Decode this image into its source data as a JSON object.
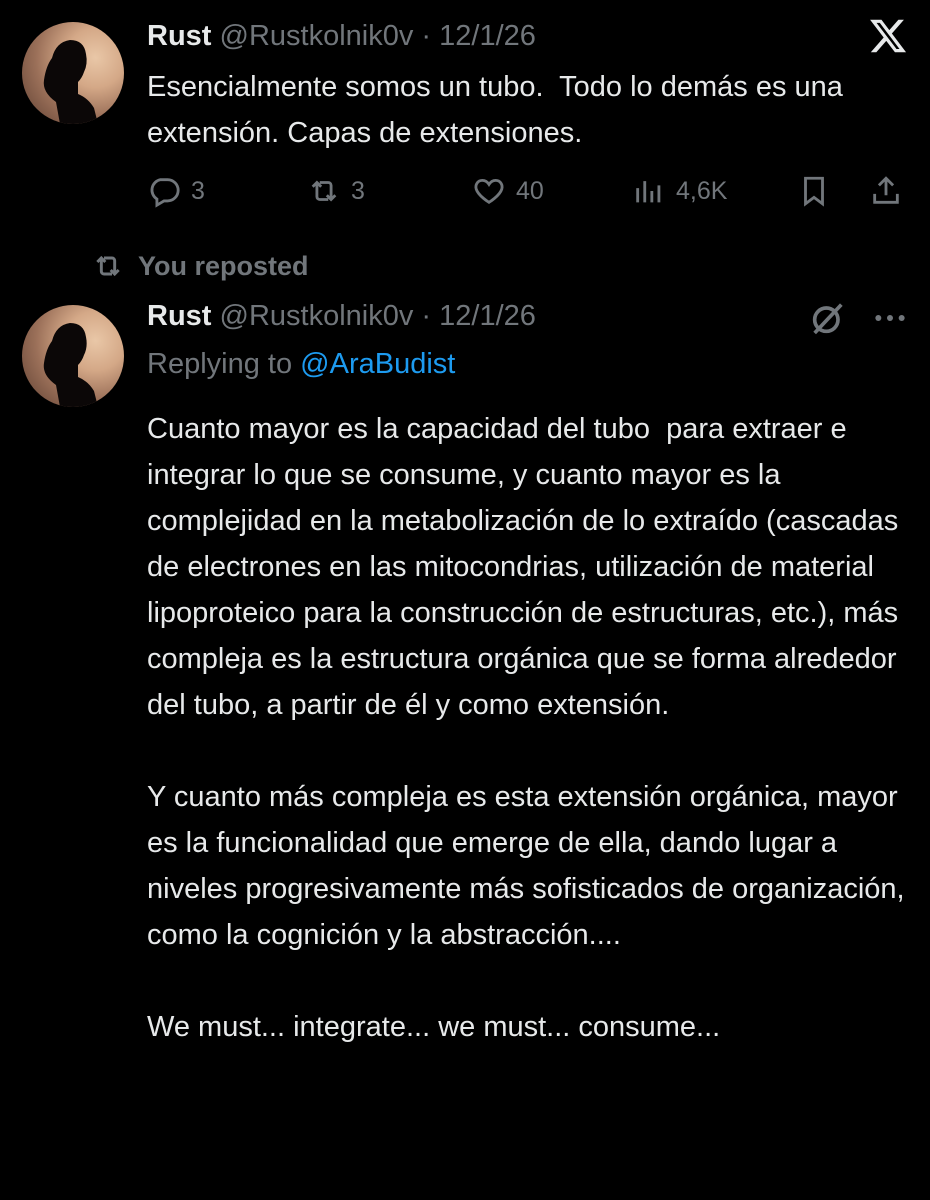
{
  "tweet1": {
    "name": "Rust",
    "handle": "@Rustkolnik0v",
    "separator": "·",
    "date": "12/1/26",
    "text": "Esencialmente somos un tubo.  Todo lo demás es una extensión. Capas de extensiones.",
    "replies": "3",
    "reposts": "3",
    "likes": "40",
    "views": "4,6K"
  },
  "repost_banner": {
    "label": "You reposted"
  },
  "tweet2": {
    "name": "Rust",
    "handle": "@Rustkolnik0v",
    "separator": "·",
    "date": "12/1/26",
    "replying_prefix": "Replying to",
    "replying_to": "@AraBudist",
    "text": "Cuanto mayor es la capacidad del tubo  para extraer e integrar lo que se consume, y cuanto mayor es la complejidad en la metabolización de lo extraído (cascadas de electrones en las mitocondrias, utilización de material lipoproteico para la construcción de estructuras, etc.), más compleja es la estructura orgánica que se forma alrededor del tubo, a partir de él y como extensión.\n\nY cuanto más compleja es esta extensión orgánica, mayor es la funcionalidad que emerge de ella, dando lugar a niveles progresivamente más sofisticados de organización, como la cognición y la abstracción....\n\nWe must... integrate... we must... consume...",
    "more_label": "···"
  },
  "colors": {
    "background": "#000000",
    "text": "#e7e9ea",
    "muted": "#71767b",
    "link": "#1d9bf0"
  },
  "icons": [
    "x-logo-icon",
    "reply-icon",
    "repost-icon",
    "like-icon",
    "views-icon",
    "bookmark-icon",
    "share-icon",
    "grok-icon",
    "more-icon"
  ]
}
